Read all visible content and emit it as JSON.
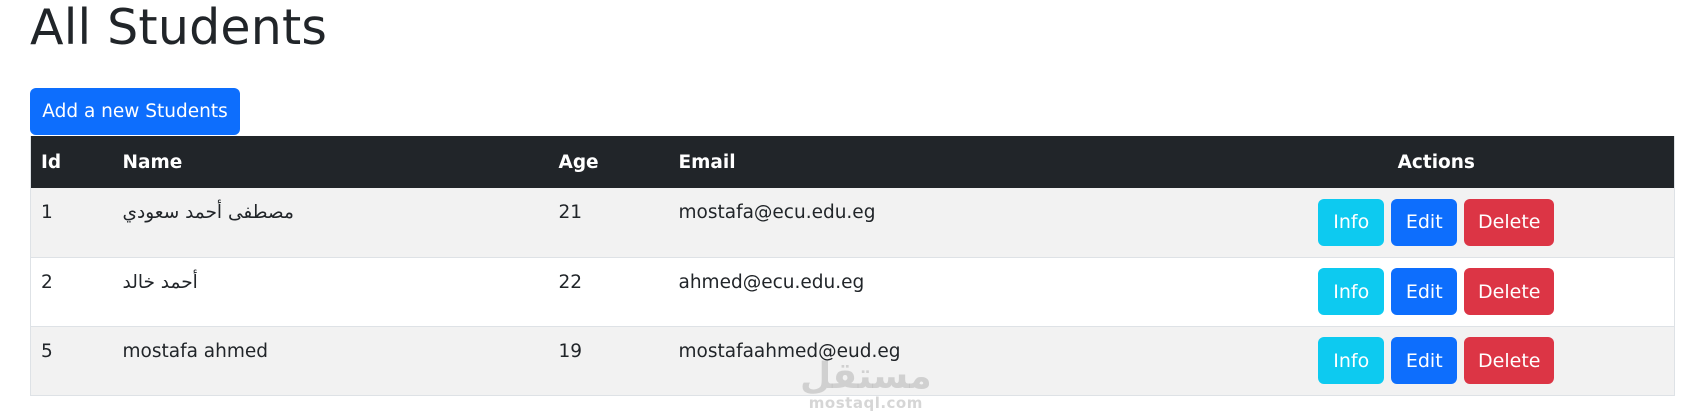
{
  "page": {
    "title": "All Students",
    "add_button_label": "Add a new Students"
  },
  "table": {
    "headers": {
      "id": "Id",
      "name": "Name",
      "age": "Age",
      "email": "Email",
      "actions": "Actions"
    },
    "rows": [
      {
        "id": "1",
        "name": "مصطفى أحمد سعودي",
        "age": "21",
        "email": "mostafa@ecu.edu.eg"
      },
      {
        "id": "2",
        "name": "أحمد خالد",
        "age": "22",
        "email": "ahmed@ecu.edu.eg"
      },
      {
        "id": "5",
        "name": "mostafa ahmed",
        "age": "19",
        "email": "mostafaahmed@eud.eg"
      }
    ],
    "actions": {
      "info": "Info",
      "edit": "Edit",
      "delete": "Delete"
    }
  },
  "watermark": {
    "arabic": "مستقل",
    "latin": "mostaql.com"
  },
  "colors": {
    "primary": "#0d6efd",
    "info": "#0dcaf0",
    "danger": "#dc3545",
    "header_dark": "#212529"
  }
}
